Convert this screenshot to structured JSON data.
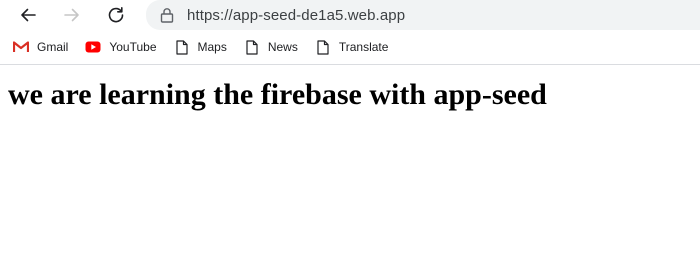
{
  "browser": {
    "url": "https://app-seed-de1a5.web.app",
    "nav": {
      "back_icon": "arrow-left-icon",
      "forward_icon": "arrow-right-icon",
      "reload_icon": "reload-icon",
      "lock_icon": "lock-icon"
    },
    "bookmarks": [
      {
        "label": "Gmail",
        "icon": "gmail-icon"
      },
      {
        "label": "YouTube",
        "icon": "youtube-icon"
      },
      {
        "label": "Maps",
        "icon": "page-icon"
      },
      {
        "label": "News",
        "icon": "page-icon"
      },
      {
        "label": "Translate",
        "icon": "page-icon"
      }
    ]
  },
  "page": {
    "heading": "we are learning the firebase with app-seed"
  },
  "colors": {
    "address_bar_bg": "#f1f3f4",
    "gmail_red": "#d93025",
    "youtube_red": "#ff0000",
    "text": "#202124"
  }
}
